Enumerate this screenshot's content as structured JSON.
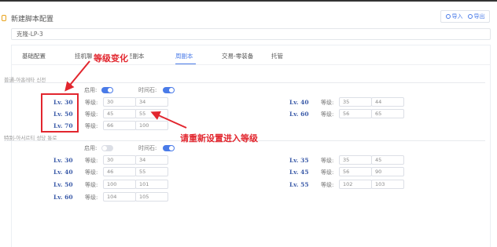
{
  "header": {
    "title": "新建脚本配置",
    "import_label": "导入",
    "export_label": "导出"
  },
  "name_field": {
    "value": "克隆-LP-3"
  },
  "tabs": [
    {
      "label": "基础配置"
    },
    {
      "label": "挂机聊天"
    },
    {
      "label": "至副本"
    },
    {
      "label": "周副本",
      "active": true
    },
    {
      "label": "交易-零装备"
    },
    {
      "label": "托管"
    }
  ],
  "sections": [
    {
      "title": "普通-아홉레타 신전",
      "enable_label": "启用:",
      "enable_on": true,
      "time_label": "时间石:",
      "time_on": true,
      "level_label": "等级:",
      "rows_left": [
        {
          "lv": "Lv. 30",
          "a": "30",
          "b": "34"
        },
        {
          "lv": "Lv. 50",
          "a": "45",
          "b": "55"
        },
        {
          "lv": "Lv. 70",
          "a": "66",
          "b": "100"
        }
      ],
      "rows_right": [
        {
          "lv": "Lv. 40",
          "a": "35",
          "b": "44"
        },
        {
          "lv": "Lv. 60",
          "a": "56",
          "b": "65"
        }
      ]
    },
    {
      "title": "特别-아서르티 성당 통로",
      "enable_label": "启用:",
      "enable_on": false,
      "time_label": "时间石:",
      "time_on": true,
      "level_label": "等级:",
      "rows_left": [
        {
          "lv": "Lv. 30",
          "a": "30",
          "b": "34"
        },
        {
          "lv": "Lv. 40",
          "a": "46",
          "b": "55"
        },
        {
          "lv": "Lv. 50",
          "a": "100",
          "b": "101"
        },
        {
          "lv": "Lv. 60",
          "a": "104",
          "b": "105"
        }
      ],
      "rows_right": [
        {
          "lv": "Lv. 35",
          "a": "35",
          "b": "45"
        },
        {
          "lv": "Lv. 45",
          "a": "56",
          "b": "90"
        },
        {
          "lv": "Lv. 55",
          "a": "102",
          "b": "103"
        }
      ]
    }
  ],
  "annotations": {
    "level_change": "等级变化",
    "reset_hint": "请重新设置进入等级",
    "color": "#e2262e"
  }
}
